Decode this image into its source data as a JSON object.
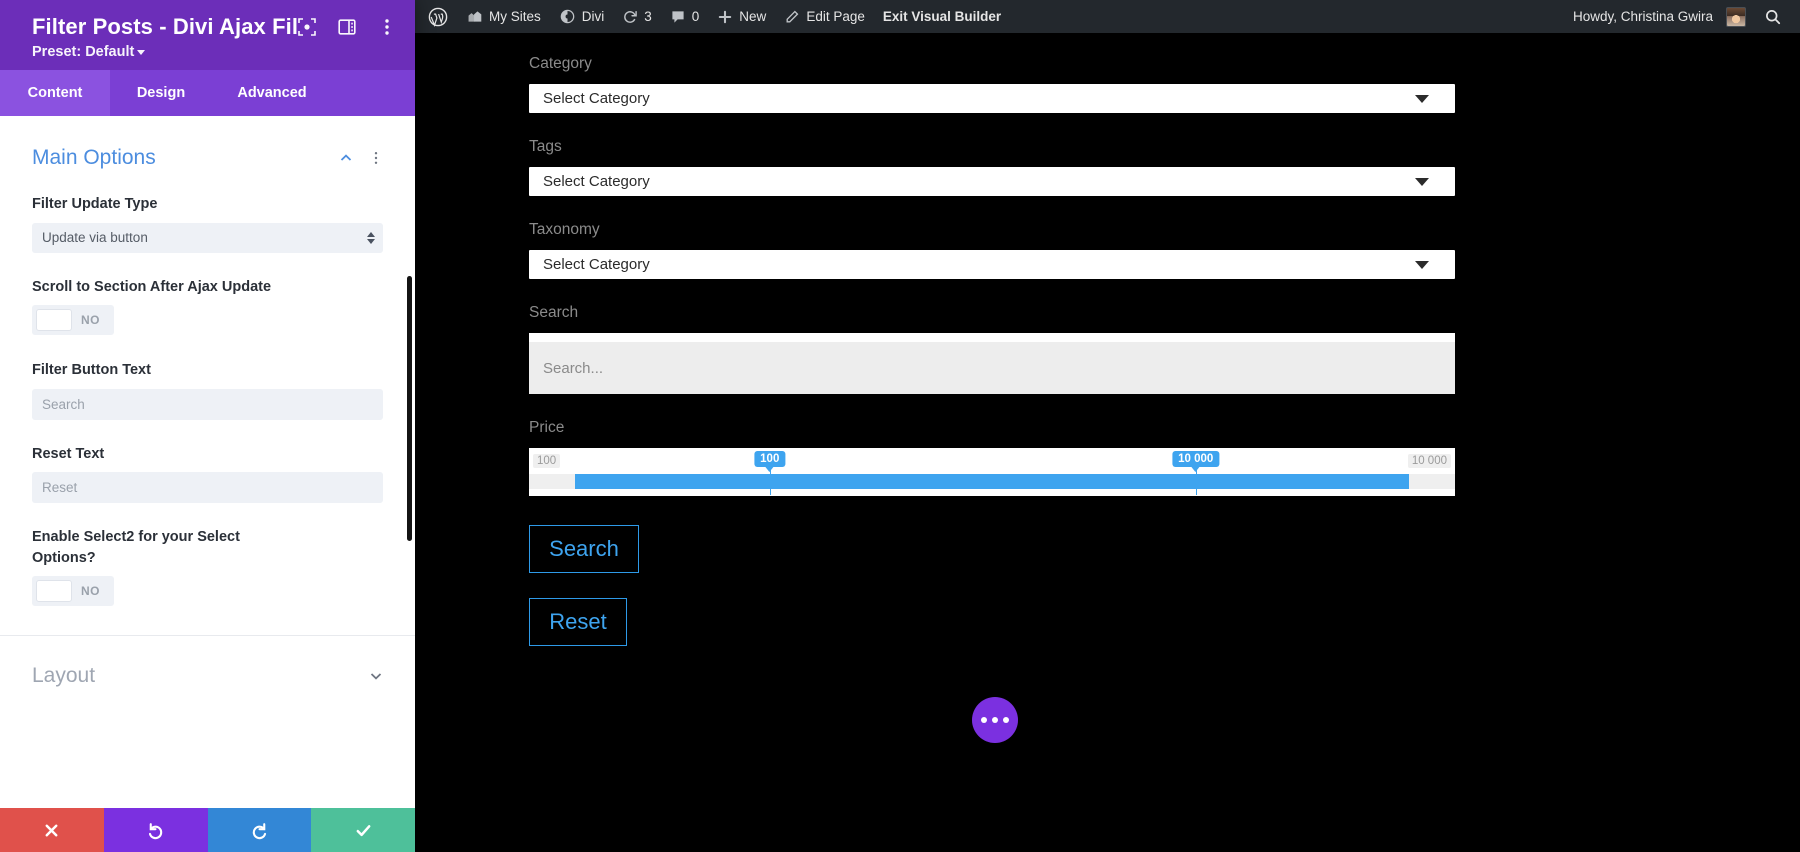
{
  "divi_panel": {
    "title": "Filter Posts - Divi Ajax Filter...",
    "preset_label": "Preset: Default",
    "icons": {
      "focus": "focus-module-icon",
      "layout": "panel-layout-icon",
      "more": "vertical-ellipsis-icon"
    },
    "tabs": [
      {
        "id": "content",
        "label": "Content",
        "active": true
      },
      {
        "id": "design",
        "label": "Design",
        "active": false
      },
      {
        "id": "advanced",
        "label": "Advanced",
        "active": false
      }
    ],
    "sections": [
      {
        "id": "main-options",
        "title": "Main Options",
        "expanded": true
      },
      {
        "id": "layout",
        "title": "Layout",
        "expanded": false
      }
    ],
    "fields": {
      "filter_update_type": {
        "label": "Filter Update Type",
        "value": "Update via button"
      },
      "scroll_to_section": {
        "label": "Scroll to Section After Ajax Update",
        "value": "NO"
      },
      "filter_button_text": {
        "label": "Filter Button Text",
        "placeholder": "Search"
      },
      "reset_text": {
        "label": "Reset Text",
        "placeholder": "Reset"
      },
      "enable_select2": {
        "label": "Enable Select2 for your Select Options?",
        "value": "NO"
      }
    },
    "footer_actions": [
      {
        "id": "cancel",
        "icon": "close-x-icon",
        "color": "#e0514b"
      },
      {
        "id": "undo",
        "icon": "undo-icon",
        "color": "#7b30e0"
      },
      {
        "id": "redo",
        "icon": "redo-icon",
        "color": "#3387d6"
      },
      {
        "id": "save",
        "icon": "checkmark-icon",
        "color": "#4ec09a"
      }
    ]
  },
  "admin_bar": {
    "items": [
      {
        "id": "wp-logo",
        "icon": "wordpress-logo-icon",
        "label": ""
      },
      {
        "id": "my-sites",
        "icon": "sites-icon",
        "label": "My Sites"
      },
      {
        "id": "divi",
        "icon": "divi-icon",
        "label": "Divi"
      },
      {
        "id": "updates",
        "icon": "updates-icon",
        "label": "3"
      },
      {
        "id": "comments",
        "icon": "comment-bubble-icon",
        "label": "0"
      },
      {
        "id": "new",
        "icon": "plus-icon",
        "label": "New"
      },
      {
        "id": "edit-page",
        "icon": "pencil-icon",
        "label": "Edit Page"
      },
      {
        "id": "exit-builder",
        "icon": "",
        "label": "Exit Visual Builder"
      }
    ],
    "account": {
      "greeting": "Howdy, Christina Gwira",
      "avatar": "user-avatar"
    },
    "search_icon": "search-icon",
    "background": "#23282d"
  },
  "page": {
    "background": "#000000",
    "fields": [
      {
        "id": "category",
        "label": "Category",
        "type": "select",
        "value": "Select Category"
      },
      {
        "id": "tags",
        "label": "Tags",
        "type": "select",
        "value": "Select Category"
      },
      {
        "id": "taxonomy",
        "label": "Taxonomy",
        "type": "select",
        "value": "Select Category"
      }
    ],
    "search": {
      "label": "Search",
      "placeholder": "Search..."
    },
    "price": {
      "label": "Price",
      "min_edge_label": "100",
      "max_edge_label": "10 000",
      "lower_value": "100",
      "upper_value": "10 000",
      "lower_pct": 26,
      "upper_pct": 72,
      "fill_start_pct": 5,
      "fill_end_pct": 95,
      "accent": "#3ea4ef"
    },
    "buttons": {
      "search": "Search",
      "reset": "Reset",
      "accent": "#3ea4ef"
    },
    "fab": {
      "icon": "ellipsis-icon",
      "color": "#7b30e0"
    }
  }
}
